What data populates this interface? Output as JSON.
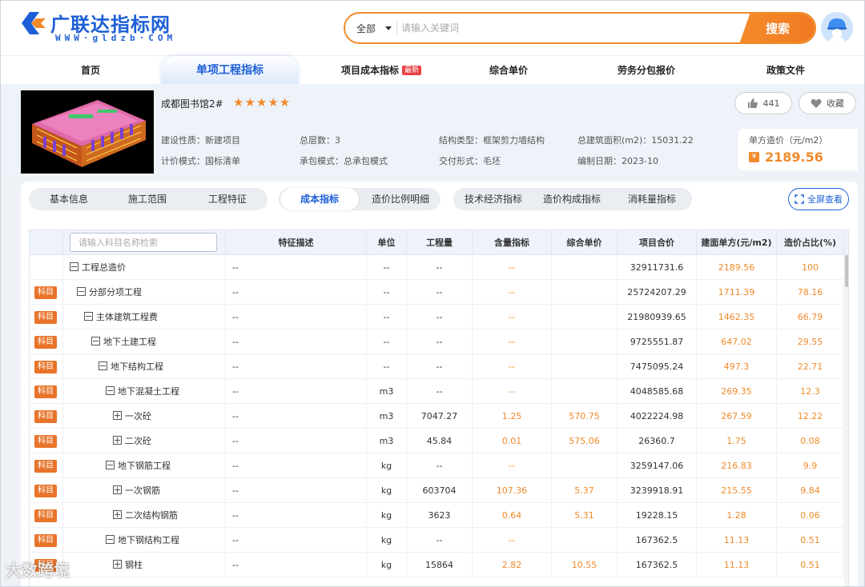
{
  "logo": {
    "title": "广联达指标网",
    "subtitle": "WWW·gldzb·COM",
    "brand_color": "#1d5fd6"
  },
  "search": {
    "scope": "全部",
    "placeholder": "请输入关键词",
    "value": "",
    "button": "搜索",
    "accent": "#f08a2a"
  },
  "nav": {
    "items": [
      {
        "label": "首页"
      },
      {
        "label": "单项工程指标"
      },
      {
        "label": "项目成本指标",
        "badge": "最新"
      },
      {
        "label": "综合单价"
      },
      {
        "label": "劳务分包报价"
      },
      {
        "label": "政策文件"
      }
    ]
  },
  "project": {
    "name": "成都图书馆2#",
    "stars": "★★★★★",
    "likes": "441",
    "fav_label": "收藏",
    "meta": [
      {
        "label": "建设性质：",
        "value": "新建项目"
      },
      {
        "label": "总层数：",
        "value": "3"
      },
      {
        "label": "结构类型：",
        "value": "框架剪力墙结构"
      },
      {
        "label": "总建筑面积(m2)：",
        "value": "15031.22"
      },
      {
        "label": "计价模式：",
        "value": "国标清单"
      },
      {
        "label": "承包模式：",
        "value": "总承包模式"
      },
      {
        "label": "交付形式：",
        "value": "毛坯"
      },
      {
        "label": "编制日期：",
        "value": "2023-10"
      }
    ],
    "unit_price_label": "单方造价（元/m2）",
    "unit_price_symbol": "¥",
    "unit_price": "2189.56"
  },
  "tabs": {
    "group1": [
      "基本信息",
      "施工范围",
      "工程特征"
    ],
    "group2": [
      "成本指标",
      "造价比例明细"
    ],
    "group3": [
      "技术经济指标",
      "造价构成指标",
      "消耗量指标"
    ],
    "fullscreen": "全屏查看"
  },
  "table": {
    "filter_placeholder": "请输入科目名称检索",
    "columns": [
      "特征描述",
      "单位",
      "工程量",
      "含量指标",
      "综合单价",
      "项目合价",
      "建面单方(元/m2)",
      "造价占比(%)"
    ],
    "tag_label": "科目",
    "rows": [
      {
        "tag": false,
        "level": 0,
        "expanded": true,
        "name": "工程总造价",
        "desc": "--",
        "unit": "--",
        "qty": "--",
        "content": "--",
        "price": "",
        "total": "32911731.6",
        "unit_cost": "2189.56",
        "ratio": "100"
      },
      {
        "tag": true,
        "level": 1,
        "expanded": true,
        "name": "分部分项工程",
        "desc": "--",
        "unit": "--",
        "qty": "--",
        "content": "--",
        "price": "",
        "total": "25724207.29",
        "unit_cost": "1711.39",
        "ratio": "78.16"
      },
      {
        "tag": true,
        "level": 2,
        "expanded": true,
        "name": "主体建筑工程费",
        "desc": "--",
        "unit": "--",
        "qty": "--",
        "content": "--",
        "price": "",
        "total": "21980939.65",
        "unit_cost": "1462.35",
        "ratio": "66.79"
      },
      {
        "tag": true,
        "level": 3,
        "expanded": true,
        "name": "地下土建工程",
        "desc": "--",
        "unit": "--",
        "qty": "--",
        "content": "--",
        "price": "",
        "total": "9725551.87",
        "unit_cost": "647.02",
        "ratio": "29.55"
      },
      {
        "tag": true,
        "level": 4,
        "expanded": true,
        "name": "地下结构工程",
        "desc": "--",
        "unit": "--",
        "qty": "--",
        "content": "--",
        "price": "",
        "total": "7475095.24",
        "unit_cost": "497.3",
        "ratio": "22.71"
      },
      {
        "tag": true,
        "level": 5,
        "expanded": true,
        "name": "地下混凝土工程",
        "desc": "--",
        "unit": "m3",
        "qty": "--",
        "content": "--",
        "price": "",
        "total": "4048585.68",
        "unit_cost": "269.35",
        "ratio": "12.3"
      },
      {
        "tag": true,
        "level": 6,
        "expanded": false,
        "name": "一次砼",
        "desc": "--",
        "unit": "m3",
        "qty": "7047.27",
        "content": "1.25",
        "price": "570.75",
        "total": "4022224.98",
        "unit_cost": "267.59",
        "ratio": "12.22"
      },
      {
        "tag": true,
        "level": 6,
        "expanded": false,
        "name": "二次砼",
        "desc": "--",
        "unit": "m3",
        "qty": "45.84",
        "content": "0.01",
        "price": "575.06",
        "total": "26360.7",
        "unit_cost": "1.75",
        "ratio": "0.08"
      },
      {
        "tag": true,
        "level": 5,
        "expanded": true,
        "name": "地下钢筋工程",
        "desc": "--",
        "unit": "kg",
        "qty": "--",
        "content": "--",
        "price": "",
        "total": "3259147.06",
        "unit_cost": "216.83",
        "ratio": "9.9"
      },
      {
        "tag": true,
        "level": 6,
        "expanded": false,
        "name": "一次钢筋",
        "desc": "--",
        "unit": "kg",
        "qty": "603704",
        "content": "107.36",
        "price": "5.37",
        "total": "3239918.91",
        "unit_cost": "215.55",
        "ratio": "9.84"
      },
      {
        "tag": true,
        "level": 6,
        "expanded": false,
        "name": "二次结构钢筋",
        "desc": "--",
        "unit": "kg",
        "qty": "3623",
        "content": "0.64",
        "price": "5.31",
        "total": "19228.15",
        "unit_cost": "1.28",
        "ratio": "0.06"
      },
      {
        "tag": true,
        "level": 5,
        "expanded": true,
        "name": "地下钢结构工程",
        "desc": "--",
        "unit": "kg",
        "qty": "--",
        "content": "--",
        "price": "",
        "total": "167362.5",
        "unit_cost": "11.13",
        "ratio": "0.51"
      },
      {
        "tag": true,
        "level": 6,
        "expanded": false,
        "name": "钢柱",
        "desc": "--",
        "unit": "kg",
        "qty": "15864",
        "content": "2.82",
        "price": "10.55",
        "total": "167362.5",
        "unit_cost": "11.13",
        "ratio": "0.51"
      }
    ]
  },
  "watermark": "大数跨境"
}
